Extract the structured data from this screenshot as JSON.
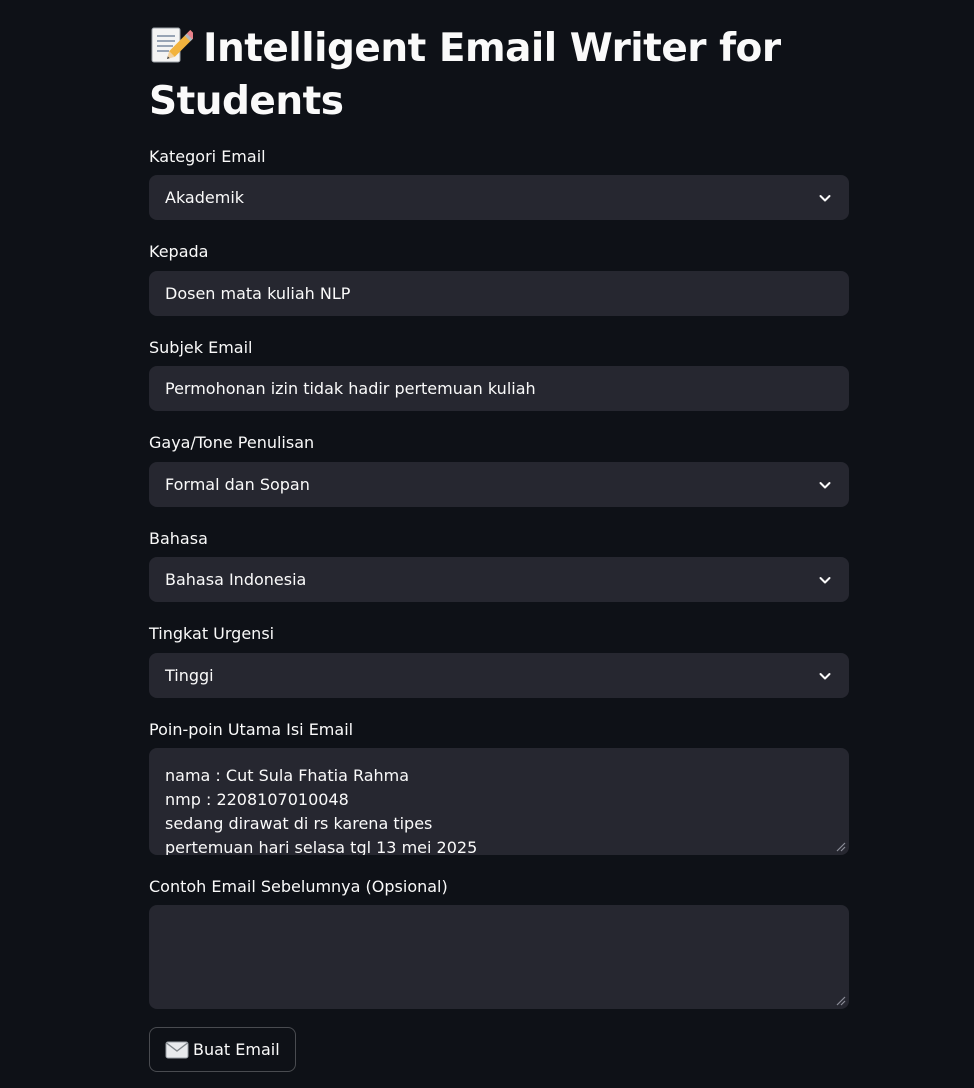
{
  "app": {
    "title": "Intelligent Email Writer for Students",
    "title_icon": "memo-icon"
  },
  "form": {
    "category": {
      "label": "Kategori Email",
      "value": "Akademik"
    },
    "recipient": {
      "label": "Kepada",
      "value": "Dosen mata kuliah NLP"
    },
    "subject": {
      "label": "Subjek Email",
      "value": "Permohonan izin tidak hadir pertemuan kuliah"
    },
    "tone": {
      "label": "Gaya/Tone Penulisan",
      "value": "Formal dan Sopan"
    },
    "language": {
      "label": "Bahasa",
      "value": "Bahasa Indonesia"
    },
    "urgency": {
      "label": "Tingkat Urgensi",
      "value": "Tinggi"
    },
    "key_points": {
      "label": "Poin-poin Utama Isi Email",
      "lines": [
        "nama : Cut Sula Fhatia Rahma",
        "nmp : 2208107010048",
        "sedang dirawat di rs karena tipes",
        "pertemuan hari selasa tgl 13 mei 2025"
      ]
    },
    "previous_email": {
      "label": "Contoh Email Sebelumnya (Opsional)",
      "value": ""
    },
    "submit": {
      "label": "Buat Email",
      "icon": "envelope-icon"
    }
  },
  "colors": {
    "background": "#0e1117",
    "input_background": "#262730",
    "text": "#fafafa"
  }
}
